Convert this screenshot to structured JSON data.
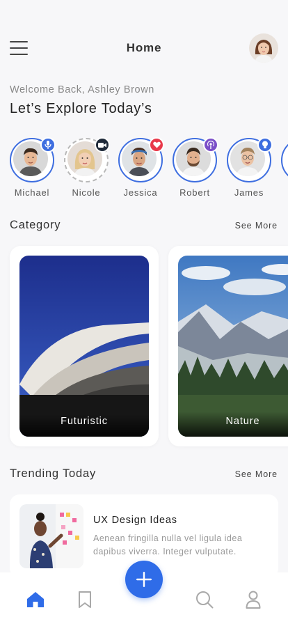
{
  "header": {
    "title": "Home",
    "menu_icon": "hamburger-menu-icon",
    "profile_avatar": "user-avatar"
  },
  "welcome": {
    "greeting": "Welcome Back, Ashley Brown",
    "headline": "Let’s Explore Today’s"
  },
  "stories": [
    {
      "name": "Michael",
      "badge_icon": "microphone-icon",
      "badge_color": "#3e6ee0",
      "seen": false
    },
    {
      "name": "Nicole",
      "badge_icon": "video-camera-icon",
      "badge_color": "#1f2a3a",
      "seen": true
    },
    {
      "name": "Jessica",
      "badge_icon": "heart-icon",
      "badge_color": "#e8394a",
      "seen": false
    },
    {
      "name": "Robert",
      "badge_icon": "podcast-icon",
      "badge_color": "#7b4fc8",
      "seen": false
    },
    {
      "name": "James",
      "badge_icon": "lightbulb-icon",
      "badge_color": "#3e6ee0",
      "seen": false
    }
  ],
  "category": {
    "title": "Category",
    "see_more": "See More",
    "items": [
      {
        "label": "Futuristic",
        "image": "futuristic-architecture-photo"
      },
      {
        "label": "Nature",
        "image": "mountain-landscape-photo"
      }
    ]
  },
  "trending": {
    "title": "Trending Today",
    "see_more": "See More",
    "items": [
      {
        "title": "UX Design Ideas",
        "description": "Aenean fringilla nulla vel ligula idea dapibus viverra. Integer vulputate.",
        "image": "presenter-whiteboard-photo"
      }
    ]
  },
  "bottom_nav": {
    "items": [
      "home-icon",
      "bookmark-icon",
      "add-icon",
      "search-icon",
      "profile-icon"
    ],
    "active": "home",
    "accent_color": "#2f6ce8"
  },
  "colors": {
    "accent": "#2f6ce8",
    "background": "#f7f7f9"
  }
}
